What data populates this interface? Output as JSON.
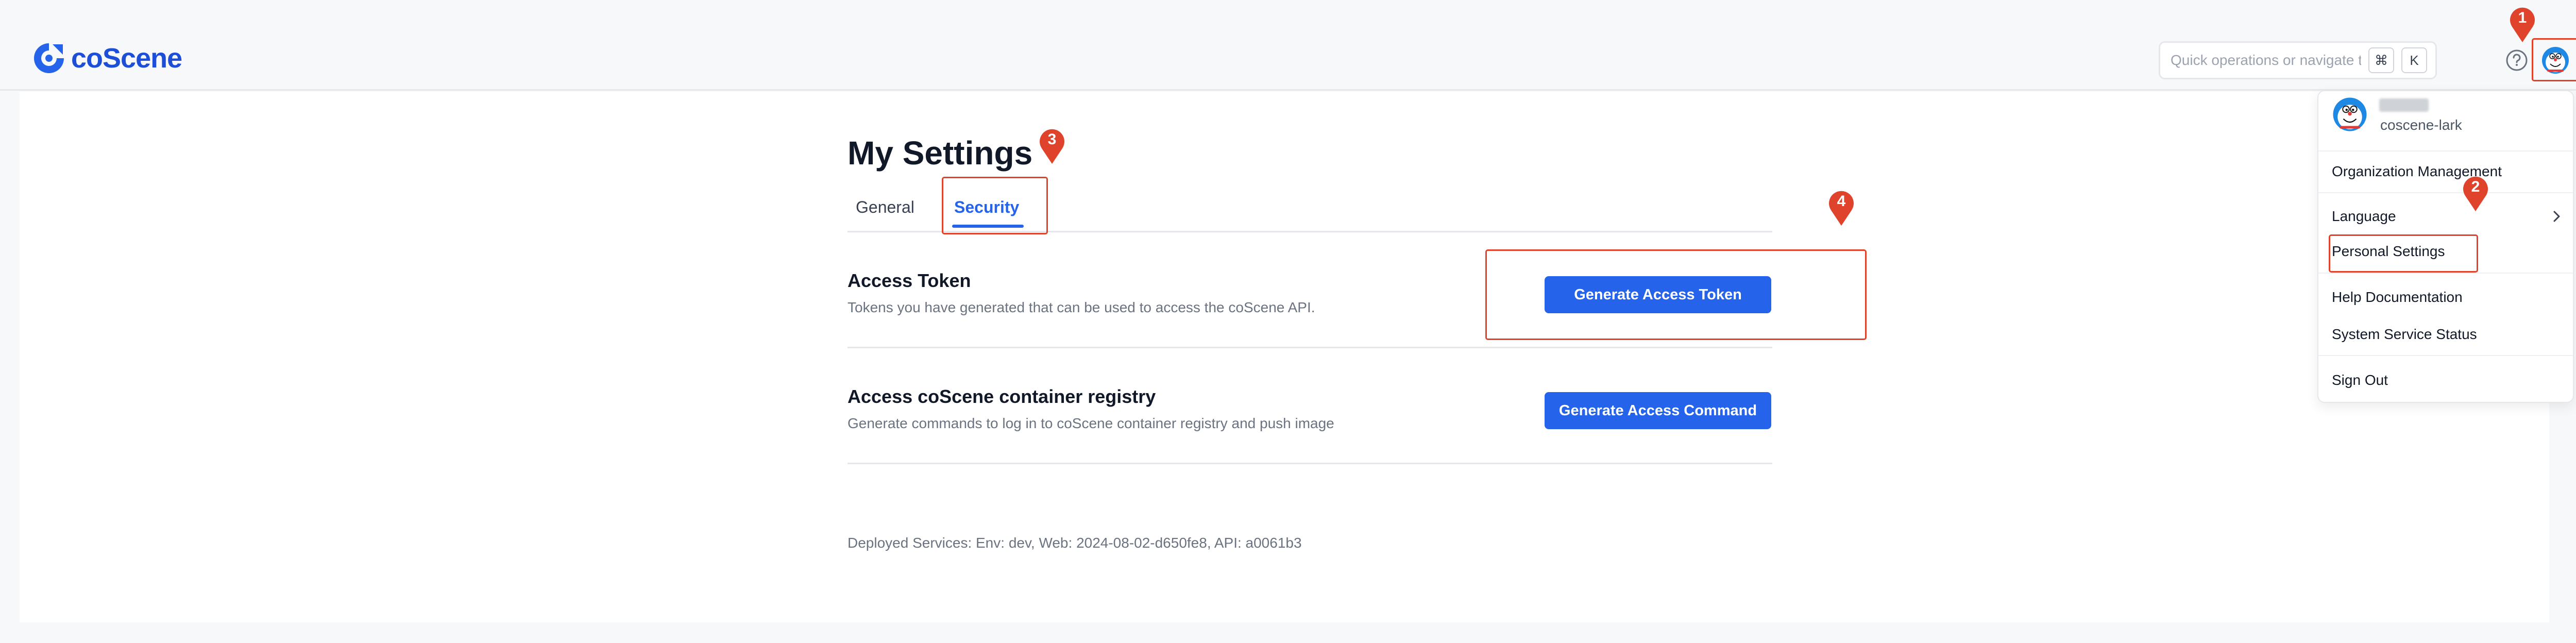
{
  "brand": {
    "name": "coScene",
    "accent": "#2563eb",
    "logo_color": "#1d4ed8"
  },
  "header": {
    "search_placeholder": "Quick operations or navigate to...",
    "shortcut_keys": [
      "⌘",
      "K"
    ],
    "help_icon": "question-circle-icon",
    "avatar_icon": "user-avatar-icon"
  },
  "settings": {
    "title": "My Settings",
    "tabs": [
      {
        "label": "General",
        "active": false
      },
      {
        "label": "Security",
        "active": true
      }
    ],
    "rows": [
      {
        "title": "Access Token",
        "description": "Tokens you have generated that can be used to access the coScene API.",
        "button": "Generate Access Token"
      },
      {
        "title": "Access coScene container registry",
        "description": "Generate commands to log in to coScene container registry and push image",
        "button": "Generate Access Command"
      }
    ],
    "footer": "Deployed Services: Env: dev, Web: 2024-08-02-d650fe8, API: a0061b3"
  },
  "user_menu": {
    "username": "coscene-lark",
    "items": [
      "Organization Management",
      "Language",
      "Personal Settings",
      "Help Documentation",
      "System Service Status",
      "Sign Out"
    ]
  },
  "annotations": {
    "markers": [
      "1",
      "2",
      "3",
      "4"
    ],
    "color": "#e0432b"
  }
}
